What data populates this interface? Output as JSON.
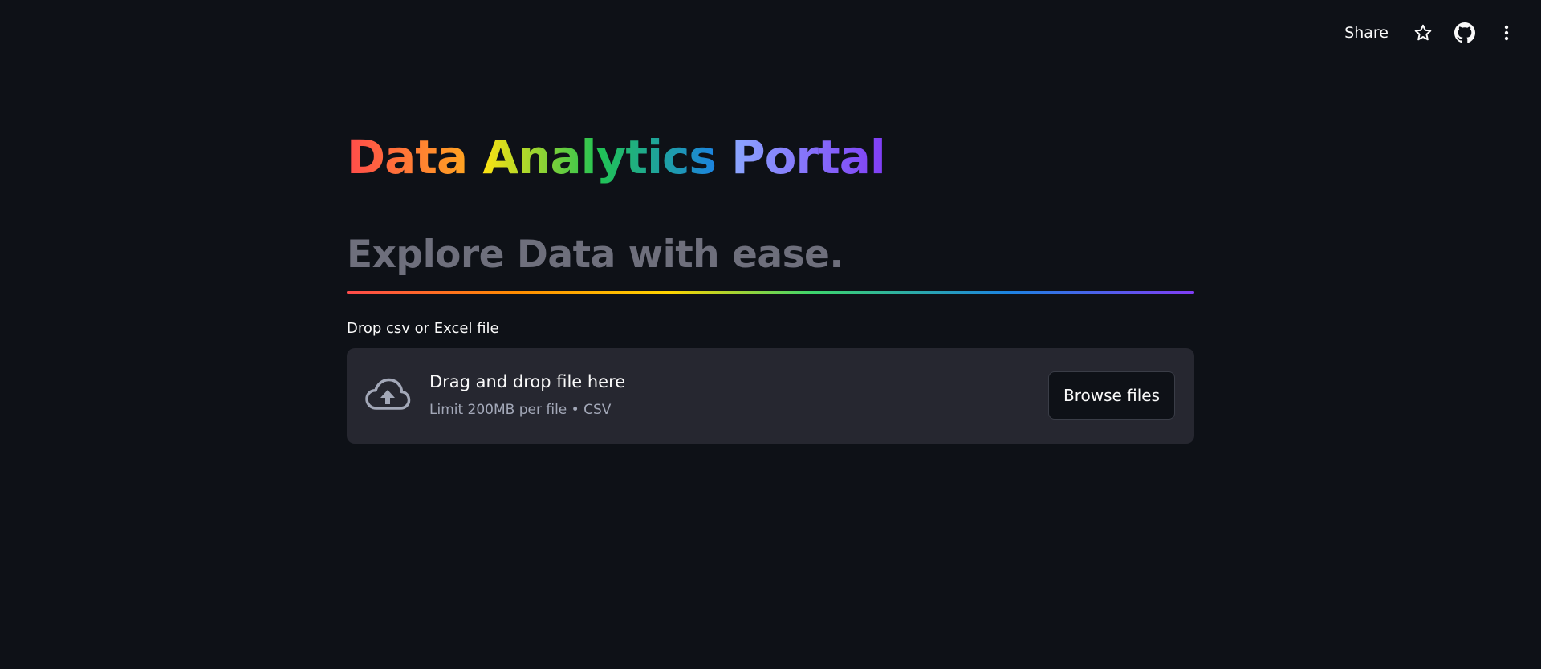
{
  "toolbar": {
    "share_label": "Share",
    "icons": [
      "star-icon",
      "github-icon",
      "more-vertical-icon"
    ]
  },
  "header": {
    "title_words": [
      {
        "text": "Data",
        "gradient": [
          "#ff4b4b",
          "#ffa421"
        ]
      },
      {
        "text": "Analytics",
        "gradient": [
          "#ffe312",
          "#21c354",
          "#1c83e1"
        ]
      },
      {
        "text": "Portal",
        "gradient": [
          "#8ba7ff",
          "#803df5"
        ]
      }
    ],
    "subtitle": "Explore Data with ease.",
    "divider": "rainbow"
  },
  "uploader": {
    "label": "Drop csv or Excel file",
    "icon": "cloud-upload-icon",
    "instructions": "Drag and drop file here",
    "limit_text": "Limit 200MB per file • CSV",
    "browse_label": "Browse files"
  },
  "colors": {
    "background": "#0e1117",
    "dropzone_background": "#262730",
    "subtitle_text": "#6e6f7c",
    "muted_text": "#a3a8b8"
  }
}
